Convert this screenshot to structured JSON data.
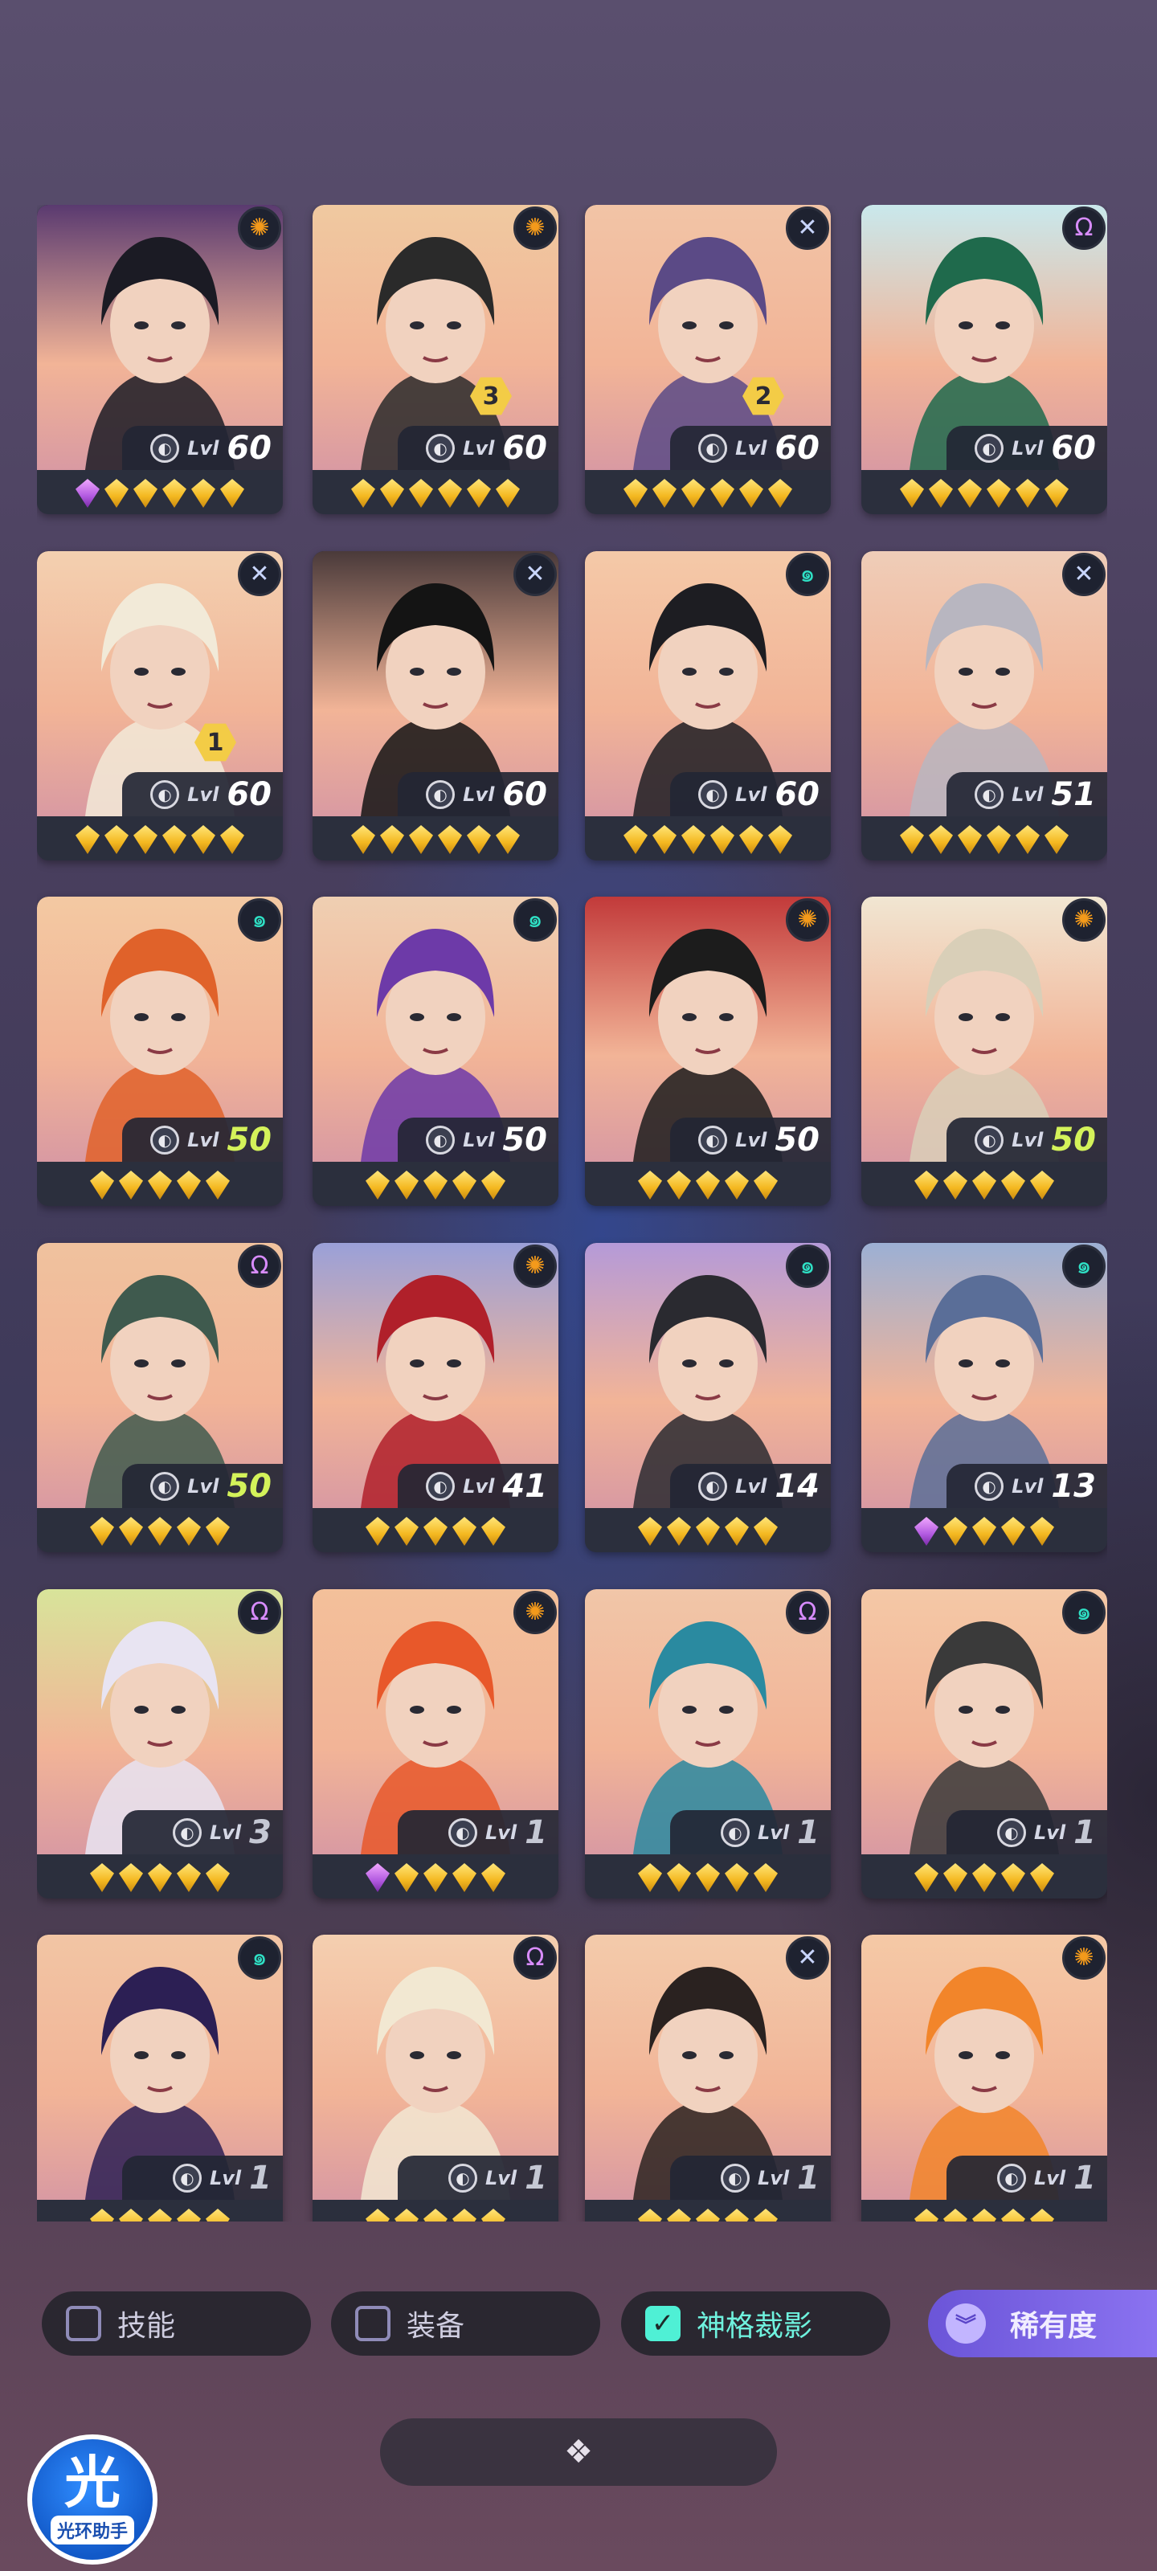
{
  "roster": {
    "lvl_prefix": "Lvl",
    "cards": [
      {
        "level": "60",
        "class_icon": "crosshair-icon",
        "class_color": "#f39a1b",
        "dupe": "",
        "gems": "p5",
        "bg": "#5a3a70",
        "accent": "#1b1b24",
        "level_color": ""
      },
      {
        "level": "60",
        "class_icon": "crosshair-icon",
        "class_color": "#f39a1b",
        "dupe": "3",
        "gems": "6",
        "bg": "#f0c9a0",
        "accent": "#2a2a2a",
        "level_color": ""
      },
      {
        "level": "60",
        "class_icon": "cross-swords-icon",
        "class_color": "#c9d6ff",
        "dupe": "2",
        "gems": "6",
        "bg": "#f2c4a6",
        "accent": "#5b4a86",
        "level_color": ""
      },
      {
        "level": "60",
        "class_icon": "omega-icon",
        "class_color": "#d88cff",
        "dupe": "",
        "gems": "6",
        "bg": "#c9e8ec",
        "accent": "#1f6a4c",
        "level_color": ""
      },
      {
        "level": "60",
        "class_icon": "cross-swords-icon",
        "class_color": "#c9d6ff",
        "dupe": "1",
        "gems": "6",
        "bg": "#f3d0b0",
        "accent": "#f2ead8",
        "level_color": ""
      },
      {
        "level": "60",
        "class_icon": "cross-swords-icon",
        "class_color": "#c9d6ff",
        "dupe": "",
        "gems": "6",
        "bg": "#4a3a3a",
        "accent": "#141414",
        "level_color": ""
      },
      {
        "level": "60",
        "class_icon": "swirl-icon",
        "class_color": "#2fe0c5",
        "dupe": "",
        "gems": "6",
        "bg": "#f4c9a8",
        "accent": "#1d1d22",
        "level_color": ""
      },
      {
        "level": "51",
        "class_icon": "cross-swords-icon",
        "class_color": "#c9d6ff",
        "dupe": "",
        "gems": "6",
        "bg": "#efcdb8",
        "accent": "#b8b6c0",
        "level_color": ""
      },
      {
        "level": "50",
        "class_icon": "swirl-icon",
        "class_color": "#2fe0c5",
        "dupe": "",
        "gems": "5",
        "bg": "#f3c9a2",
        "accent": "#e0622a",
        "level_color": "green"
      },
      {
        "level": "50",
        "class_icon": "swirl-icon",
        "class_color": "#2fe0c5",
        "dupe": "",
        "gems": "5",
        "bg": "#efcfb2",
        "accent": "#6d3aa8",
        "level_color": ""
      },
      {
        "level": "50",
        "class_icon": "crosshair-icon",
        "class_color": "#f39a1b",
        "dupe": "",
        "gems": "5",
        "bg": "#c23a3a",
        "accent": "#1c1c1c",
        "level_color": ""
      },
      {
        "level": "50",
        "class_icon": "crosshair-icon",
        "class_color": "#f39a1b",
        "dupe": "",
        "gems": "5",
        "bg": "#f1e6d2",
        "accent": "#d9cfb8",
        "level_color": "green"
      },
      {
        "level": "50",
        "class_icon": "omega-icon",
        "class_color": "#d88cff",
        "dupe": "",
        "gems": "5",
        "bg": "#f0c29e",
        "accent": "#3f5a4e",
        "level_color": "green"
      },
      {
        "level": "41",
        "class_icon": "crosshair-icon",
        "class_color": "#f39a1b",
        "dupe": "",
        "gems": "5",
        "bg": "#9aa0d8",
        "accent": "#b0202a",
        "level_color": ""
      },
      {
        "level": "14",
        "class_icon": "swirl-icon",
        "class_color": "#2fe0c5",
        "dupe": "",
        "gems": "5",
        "bg": "#b59ad8",
        "accent": "#2a2a30",
        "level_color": ""
      },
      {
        "level": "13",
        "class_icon": "swirl-icon",
        "class_color": "#2fe0c5",
        "dupe": "",
        "gems": "p4",
        "bg": "#9cb0d4",
        "accent": "#5a6e98",
        "level_color": ""
      },
      {
        "level": "3",
        "class_icon": "omega-icon",
        "class_color": "#d88cff",
        "dupe": "",
        "gems": "5",
        "bg": "#d8e49a",
        "accent": "#e8e4f2",
        "level_color": "grey"
      },
      {
        "level": "1",
        "class_icon": "crosshair-icon",
        "class_color": "#f39a1b",
        "dupe": "",
        "gems": "p4",
        "bg": "#f3c09a",
        "accent": "#e8582a",
        "level_color": "grey"
      },
      {
        "level": "1",
        "class_icon": "omega-icon",
        "class_color": "#d88cff",
        "dupe": "",
        "gems": "5",
        "bg": "#f1c6a8",
        "accent": "#2a8aa0",
        "level_color": "grey"
      },
      {
        "level": "1",
        "class_icon": "swirl-icon",
        "class_color": "#2fe0c5",
        "dupe": "",
        "gems": "5",
        "bg": "#f4c8a6",
        "accent": "#3a3a3a",
        "level_color": "grey"
      },
      {
        "level": "1",
        "class_icon": "swirl-icon",
        "class_color": "#2fe0c5",
        "dupe": "",
        "gems": "5",
        "bg": "#f2c5a4",
        "accent": "#2c1f54",
        "level_color": "grey"
      },
      {
        "level": "1",
        "class_icon": "omega-icon",
        "class_color": "#d88cff",
        "dupe": "",
        "gems": "5",
        "bg": "#f4cfb0",
        "accent": "#f2e8d2",
        "level_color": "grey"
      },
      {
        "level": "1",
        "class_icon": "cross-swords-icon",
        "class_color": "#c9d6ff",
        "dupe": "",
        "gems": "5",
        "bg": "#f3cbab",
        "accent": "#2a2220",
        "level_color": "grey"
      },
      {
        "level": "1",
        "class_icon": "crosshair-icon",
        "class_color": "#f39a1b",
        "dupe": "",
        "gems": "5",
        "bg": "#f5c9a6",
        "accent": "#f2852a",
        "level_color": "grey"
      }
    ]
  },
  "filters": {
    "skill": {
      "label": "技能",
      "checked": false
    },
    "equipment": {
      "label": "装备",
      "checked": false
    },
    "divine_shadow": {
      "label": "神格裁影",
      "checked": true
    }
  },
  "sort": {
    "label": "稀有度",
    "icon": "double-chevron-down-icon"
  },
  "expand": {
    "icon": "diamond-cluster-icon"
  },
  "app_logo": {
    "mark": "光",
    "text": "光环助手"
  },
  "colors": {
    "accent_teal": "#4ff0d5",
    "accent_purple": "#7a62e6",
    "gem_gold": "#f4b820",
    "gem_purple": "#b25ae0"
  }
}
